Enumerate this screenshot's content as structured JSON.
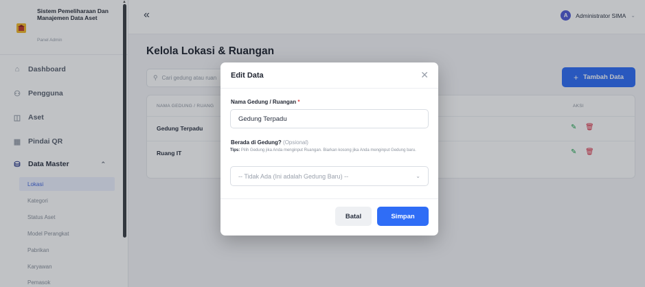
{
  "sidebar": {
    "brand_title": "Sistem Pemeliharaan Dan Manajemen Data Aset",
    "brand_subtitle": "Panel Admin",
    "logo_icon": "university-icon",
    "menu": [
      {
        "label": "Dashboard",
        "icon": "home-icon"
      },
      {
        "label": "Pengguna",
        "icon": "users-icon"
      },
      {
        "label": "Aset",
        "icon": "box-icon"
      },
      {
        "label": "Pindai QR",
        "icon": "qr-icon"
      },
      {
        "label": "Data Master",
        "icon": "database-icon"
      }
    ],
    "submenu": [
      "Lokasi",
      "Kategori",
      "Status Aset",
      "Model Perangkat",
      "Pabrikan",
      "Karyawan",
      "Pemasok"
    ],
    "active_submenu": "Lokasi"
  },
  "topbar": {
    "collapse_glyph": "«",
    "user_name": "Administrator SIMA",
    "user_initial": "A"
  },
  "main": {
    "page_title": "Kelola Lokasi & Ruangan",
    "search_placeholder": "Cari gedung atau ruan",
    "add_button": "Tambah Data",
    "table": {
      "col_name": "NAMA GEDUNG / RUANG",
      "col_action": "AKSI",
      "rows": [
        "Gedung Terpadu",
        "Ruang IT"
      ]
    }
  },
  "modal": {
    "title": "Edit Data",
    "field1_label": "Nama Gedung / Ruangan",
    "field1_required": "*",
    "field1_value": "Gedung Terpadu",
    "field2_label": "Berada di Gedung?",
    "field2_optional": "(Opsional)",
    "tips_label": "Tips:",
    "tips_text": "Pilih Gedung jika Anda menginput Ruangan. Biarkan kosong jika Anda menginput Gedung baru.",
    "select_value": "-- Tidak Ada (Ini adalah Gedung Baru) --",
    "cancel": "Batal",
    "save": "Simpan"
  },
  "colors": {
    "accent": "#2f6df6",
    "edit": "#1aa34a",
    "delete": "#d7263d"
  }
}
